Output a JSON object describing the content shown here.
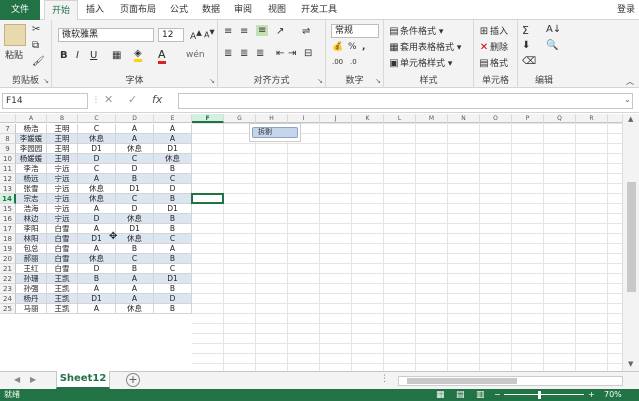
{
  "tabs": [
    "文件",
    "开始",
    "插入",
    "页面布局",
    "公式",
    "数据",
    "审阅",
    "视图",
    "开发工具"
  ],
  "login": "登录",
  "ribbon": {
    "paste": "粘贴",
    "clipboard": "剪贴板",
    "font_name": "微软雅黑",
    "font_size": "12",
    "font_group": "字体",
    "align_group": "对齐方式",
    "number_format": "常规",
    "number_group": "数字",
    "cond_format": "条件格式",
    "table_format": "套用表格格式",
    "cell_style": "单元格样式",
    "style_group": "样式",
    "insert": "插入",
    "delete": "删除",
    "format": "格式",
    "cells_group": "单元格",
    "edit_group": "编辑",
    "bold": "B",
    "italic": "I",
    "underline": "U",
    "sigma": "Σ",
    "percent": "%",
    "comma": ","
  },
  "formula_bar": {
    "name_box": "F14",
    "fx": "fx",
    "value": ""
  },
  "columns": [
    "A",
    "B",
    "C",
    "D",
    "E",
    "F",
    "G",
    "H",
    "I",
    "J",
    "K",
    "L",
    "M",
    "N",
    "O",
    "P",
    "Q",
    "R"
  ],
  "selected_column": "F",
  "selected_row": "14",
  "rows": [
    {
      "n": "7",
      "a": "杨浩",
      "b": "王明",
      "c": "C",
      "d": "A",
      "e": "A"
    },
    {
      "n": "8",
      "a": "李媛媛",
      "b": "王明",
      "c": "休息",
      "d": "A",
      "e": "A"
    },
    {
      "n": "9",
      "a": "李园园",
      "b": "王明",
      "c": "D1",
      "d": "休息",
      "e": "D1"
    },
    {
      "n": "10",
      "a": "杨媛媛",
      "b": "王明",
      "c": "D",
      "d": "C",
      "e": "休息"
    },
    {
      "n": "11",
      "a": "李浩",
      "b": "宁远",
      "c": "C",
      "d": "D",
      "e": "B"
    },
    {
      "n": "12",
      "a": "杨远",
      "b": "宁远",
      "c": "A",
      "d": "B",
      "e": "C"
    },
    {
      "n": "13",
      "a": "张雪",
      "b": "宁远",
      "c": "休息",
      "d": "D1",
      "e": "D"
    },
    {
      "n": "14",
      "a": "宗志",
      "b": "宁远",
      "c": "休息",
      "d": "C",
      "e": "B"
    },
    {
      "n": "15",
      "a": "浩海",
      "b": "宁远",
      "c": "A",
      "d": "D",
      "e": "D1"
    },
    {
      "n": "16",
      "a": "林边",
      "b": "宁远",
      "c": "D",
      "d": "休息",
      "e": "B"
    },
    {
      "n": "17",
      "a": "李阳",
      "b": "白雪",
      "c": "A",
      "d": "D1",
      "e": "B"
    },
    {
      "n": "18",
      "a": "林阳",
      "b": "白雪",
      "c": "D1",
      "d": "休息",
      "e": "C"
    },
    {
      "n": "19",
      "a": "包总",
      "b": "白雪",
      "c": "A",
      "d": "B",
      "e": "A"
    },
    {
      "n": "20",
      "a": "郝丽",
      "b": "白雪",
      "c": "休息",
      "d": "C",
      "e": "B"
    },
    {
      "n": "21",
      "a": "王红",
      "b": "白雪",
      "c": "D",
      "d": "B",
      "e": "C"
    },
    {
      "n": "22",
      "a": "孙珊",
      "b": "王凯",
      "c": "B",
      "d": "A",
      "e": "D1"
    },
    {
      "n": "23",
      "a": "孙强",
      "b": "王凯",
      "c": "A",
      "d": "A",
      "e": "B"
    },
    {
      "n": "24",
      "a": "杨丹",
      "b": "王凯",
      "c": "D1",
      "d": "A",
      "e": "D"
    },
    {
      "n": "25",
      "a": "马丽",
      "b": "王凯",
      "c": "A",
      "d": "休息",
      "e": "B"
    }
  ],
  "shape_label": "拆剔",
  "sheet_tab": "Sheet12",
  "status": {
    "ready": "就绪",
    "zoom": "70%"
  },
  "colors": {
    "accent": "#217346",
    "band": "#dce6f1"
  }
}
